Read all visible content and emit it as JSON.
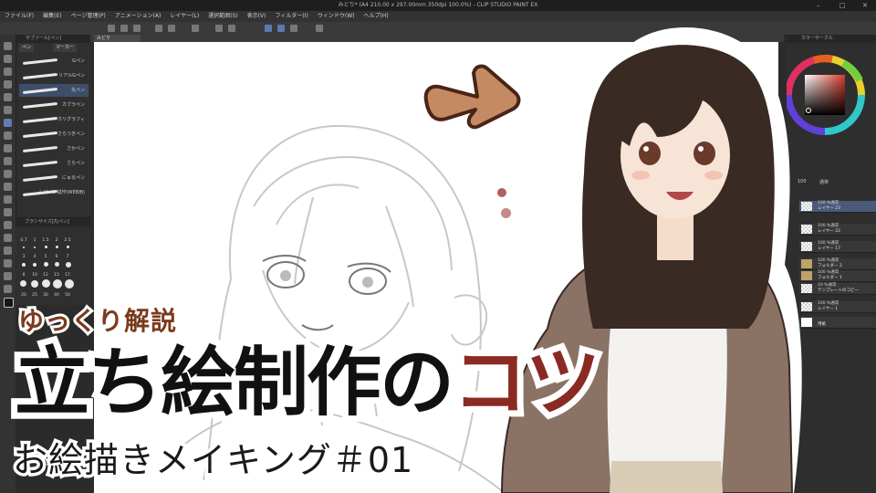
{
  "window": {
    "title": "みどり* (A4 210.00 x 297.00mm 350dpi 100.0%) - CLIP STUDIO PAINT EX",
    "controls": [
      "–",
      "□",
      "✕"
    ]
  },
  "menubar": {
    "items": [
      "ファイル(F)",
      "編集(E)",
      "ページ管理(P)",
      "アニメーション(A)",
      "レイヤー(L)",
      "選択範囲(S)",
      "表示(V)",
      "フィルター(I)",
      "ウィンドウ(W)",
      "ヘルプ(H)"
    ]
  },
  "canvas_tab": {
    "label": "みどり"
  },
  "subtool_panel": {
    "tab_label": "サブツール[ペン]",
    "groups": [
      "ペン",
      "マーカー"
    ],
    "items": [
      "Gペン",
      "リアルGペン",
      "丸ペン",
      "カブラペン",
      "カリグラフィ",
      "さらつきペン",
      "さかペン",
      "さらペン",
      "にゅるペン",
      "しげペン試作(WEB用)"
    ],
    "selected_index": 2
  },
  "brush_size_panel": {
    "tab_label": "ブラシサイズ[丸ペン]",
    "row1": [
      "0.7",
      "1",
      "1.5",
      "2",
      "2.5"
    ],
    "row2": [
      "3",
      "4",
      "5",
      "6",
      "7"
    ],
    "row3": [
      "8",
      "10",
      "12",
      "15",
      "17"
    ],
    "row4": [
      "20",
      "25",
      "30",
      "40",
      "50"
    ]
  },
  "layer_panel": {
    "tab_label": "カラーサークル",
    "opacity": "100",
    "blend": "通常",
    "layers": [
      {
        "pct": "100 %通常",
        "name": "レイヤー 23",
        "selected": true
      },
      {
        "pct": "100 %通常",
        "name": "レイヤー 22",
        "selected": false
      },
      {
        "pct": "100 %通常",
        "name": "レイヤー 17",
        "selected": false
      },
      {
        "pct": "100 %通常",
        "name": "フォルダー 2",
        "selected": false
      },
      {
        "pct": "100 %通常",
        "name": "フォルダー 1",
        "selected": false
      },
      {
        "pct": "10 %通常",
        "name": "テンプレートのコピー",
        "selected": false
      },
      {
        "pct": "100 %通常",
        "name": "レイヤー 1",
        "selected": false
      },
      {
        "pct": "",
        "name": "用紙",
        "selected": false
      }
    ]
  },
  "overlay": {
    "kicker": "ゆっくり解説",
    "title_main": "立ち絵制作の",
    "title_accent": "コツ",
    "subtitle": "お絵描きメイキング＃01"
  },
  "colors": {
    "accent_dark_red": "#8a2a22",
    "arrow_brown": "#c48a62",
    "kicker_brown": "#7a3a1c",
    "selection_blue": "#3e4e6a"
  },
  "icons": [
    "minimize-icon",
    "maximize-icon",
    "close-icon",
    "pen-tool-icon",
    "eraser-icon",
    "fill-icon",
    "color-wheel-icon",
    "arrow-icon"
  ]
}
